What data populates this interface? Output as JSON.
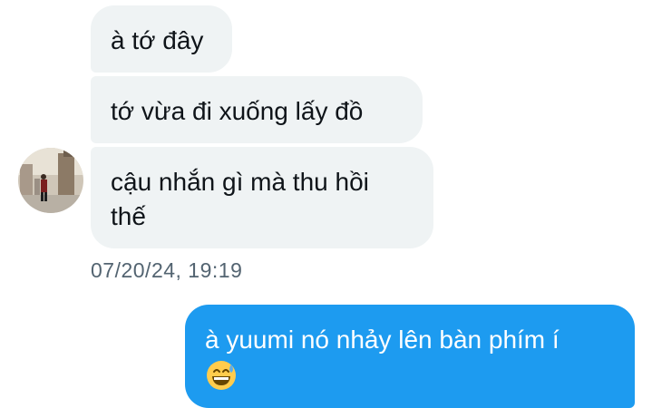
{
  "conversation": {
    "received": [
      {
        "text": "à tớ đây"
      },
      {
        "text": "tớ vừa đi xuống lấy đồ"
      },
      {
        "line1": "cậu nhắn gì mà thu hồi",
        "line2": "thế"
      }
    ],
    "received_timestamp": "07/20/24, 19:19",
    "sent": [
      {
        "text": "à yuumi nó nhảy lên bàn phím í",
        "emoji": "grinning-sweat-emoji"
      }
    ]
  },
  "colors": {
    "received_bubble": "#eff3f4",
    "sent_bubble": "#1d9bf0",
    "timestamp": "#536471",
    "text_dark": "#0f1419",
    "text_light": "#ffffff"
  }
}
